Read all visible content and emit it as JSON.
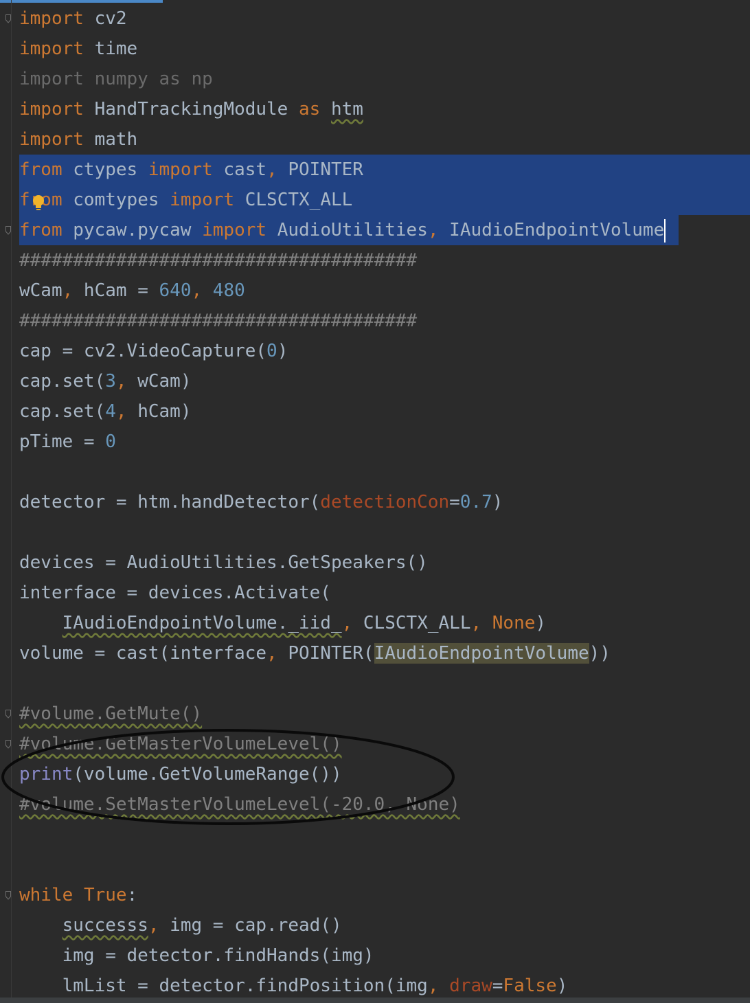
{
  "editor": {
    "language": "python",
    "lines": [
      {
        "tokens": [
          {
            "t": "import",
            "c": "kw"
          },
          {
            "t": " cv2"
          }
        ],
        "fold": true
      },
      {
        "tokens": [
          {
            "t": "import",
            "c": "kw"
          },
          {
            "t": " time"
          }
        ]
      },
      {
        "tokens": [
          {
            "t": "import numpy as np",
            "c": "unused"
          }
        ]
      },
      {
        "tokens": [
          {
            "t": "import",
            "c": "kw"
          },
          {
            "t": " HandTrackingModule "
          },
          {
            "t": "as",
            "c": "kw"
          },
          {
            "t": " "
          },
          {
            "t": "htm",
            "c": "warn"
          }
        ]
      },
      {
        "tokens": [
          {
            "t": "import",
            "c": "kw"
          },
          {
            "t": " math"
          }
        ]
      },
      {
        "tokens": [
          {
            "t": "from",
            "c": "kw"
          },
          {
            "t": " ctypes "
          },
          {
            "t": "import",
            "c": "kw"
          },
          {
            "t": " cast"
          },
          {
            "t": ",",
            "c": "kw"
          },
          {
            "t": " POINTER"
          }
        ],
        "selected": true
      },
      {
        "tokens": [
          {
            "t": "from",
            "c": "kw"
          },
          {
            "t": " comtypes "
          },
          {
            "t": "import",
            "c": "kw"
          },
          {
            "t": " CLSCTX_ALL"
          }
        ],
        "selected": true
      },
      {
        "tokens": [
          {
            "t": "from",
            "c": "kw"
          },
          {
            "t": " pycaw.pycaw "
          },
          {
            "t": "import",
            "c": "kw"
          },
          {
            "t": " AudioUtilities"
          },
          {
            "t": ",",
            "c": "kw"
          },
          {
            "t": " IAudioEndpointVolume"
          }
        ],
        "selected": true,
        "last_selected": true,
        "caret": true,
        "fold": true
      },
      {
        "tokens": [
          {
            "t": "#####################################",
            "c": "cm"
          }
        ]
      },
      {
        "tokens": [
          {
            "t": "wCam"
          },
          {
            "t": ",",
            "c": "kw"
          },
          {
            "t": " hCam = "
          },
          {
            "t": "640",
            "c": "num"
          },
          {
            "t": ",",
            "c": "kw"
          },
          {
            "t": " "
          },
          {
            "t": "480",
            "c": "num"
          }
        ]
      },
      {
        "tokens": [
          {
            "t": "#####################################",
            "c": "cm"
          }
        ]
      },
      {
        "tokens": [
          {
            "t": "cap = cv2.VideoCapture("
          },
          {
            "t": "0",
            "c": "num"
          },
          {
            "t": ")"
          }
        ]
      },
      {
        "tokens": [
          {
            "t": "cap.set("
          },
          {
            "t": "3",
            "c": "num"
          },
          {
            "t": ",",
            "c": "kw"
          },
          {
            "t": " wCam)"
          }
        ]
      },
      {
        "tokens": [
          {
            "t": "cap.set("
          },
          {
            "t": "4",
            "c": "num"
          },
          {
            "t": ",",
            "c": "kw"
          },
          {
            "t": " hCam)"
          }
        ]
      },
      {
        "tokens": [
          {
            "t": "pTime = "
          },
          {
            "t": "0",
            "c": "num"
          }
        ]
      },
      {
        "tokens": []
      },
      {
        "tokens": [
          {
            "t": "detector = htm.handDetector("
          },
          {
            "t": "detectionCon",
            "c": "param"
          },
          {
            "t": "="
          },
          {
            "t": "0.7",
            "c": "num"
          },
          {
            "t": ")"
          }
        ]
      },
      {
        "tokens": []
      },
      {
        "tokens": [
          {
            "t": "devices = AudioUtilities.GetSpeakers()"
          }
        ]
      },
      {
        "tokens": [
          {
            "t": "interface = devices.Activate("
          }
        ]
      },
      {
        "tokens": [
          {
            "t": "    "
          },
          {
            "t": "IAudioEndpointVolume._iid_",
            "c": "warn"
          },
          {
            "t": ",",
            "c": "kw"
          },
          {
            "t": " CLSCTX_ALL"
          },
          {
            "t": ",",
            "c": "kw"
          },
          {
            "t": " "
          },
          {
            "t": "None",
            "c": "kw"
          },
          {
            "t": ")"
          }
        ]
      },
      {
        "tokens": [
          {
            "t": "volume = cast(interface"
          },
          {
            "t": ",",
            "c": "kw"
          },
          {
            "t": " POINTER("
          },
          {
            "t": "IAudioEndpointVolume",
            "c": "hl"
          },
          {
            "t": "))"
          }
        ]
      },
      {
        "tokens": []
      },
      {
        "tokens": [
          {
            "t": "#volume.GetMute()",
            "c": "cm warn"
          }
        ],
        "fold": true
      },
      {
        "tokens": [
          {
            "t": "#volume.GetMasterVolumeLevel()",
            "c": "cm warn"
          }
        ],
        "fold": true
      },
      {
        "tokens": [
          {
            "t": "print",
            "c": "builtin"
          },
          {
            "t": "(volume.GetVolumeRange())"
          }
        ]
      },
      {
        "tokens": [
          {
            "t": "#volume.SetMasterVolumeLevel(-20.0, None)",
            "c": "cm warn"
          }
        ]
      },
      {
        "tokens": []
      },
      {
        "tokens": []
      },
      {
        "tokens": [
          {
            "t": "while",
            "c": "kw"
          },
          {
            "t": " "
          },
          {
            "t": "True",
            "c": "kw"
          },
          {
            "t": ":"
          }
        ],
        "fold": true
      },
      {
        "tokens": [
          {
            "t": "    "
          },
          {
            "t": "successs",
            "c": "warn"
          },
          {
            "t": ",",
            "c": "kw"
          },
          {
            "t": " img = cap.read()"
          }
        ]
      },
      {
        "tokens": [
          {
            "t": "    img = detector.findHands(img)"
          }
        ]
      },
      {
        "tokens": [
          {
            "t": "    lmList = detector.findPosition(img"
          },
          {
            "t": ",",
            "c": "kw"
          },
          {
            "t": " "
          },
          {
            "t": "draw",
            "c": "param"
          },
          {
            "t": "="
          },
          {
            "t": "False",
            "c": "kw"
          },
          {
            "t": ")"
          }
        ]
      }
    ]
  },
  "colors": {
    "background": "#2b2b2b",
    "keyword": "#cc7832",
    "number": "#6897bb",
    "comment": "#808080",
    "selection": "#214283",
    "builtin": "#8888c6",
    "param": "#aa4926"
  },
  "icons": {
    "intention": "lightbulb-icon",
    "fold": "fold-marker-icon"
  }
}
